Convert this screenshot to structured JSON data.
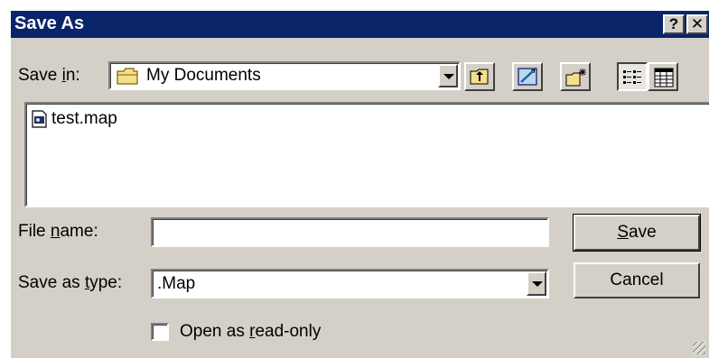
{
  "window": {
    "title": "Save As",
    "help_button": "?",
    "close_button": "✕"
  },
  "save_in": {
    "label_prefix": "Save ",
    "label_accel": "i",
    "label_suffix": "n:",
    "value": "My Documents"
  },
  "toolbar": {
    "icons": [
      "up-one-level-icon",
      "go-to-last-folder-icon",
      "create-new-folder-icon",
      "list-view-icon",
      "details-view-icon"
    ]
  },
  "file_list": {
    "items": [
      {
        "name": "test.map"
      }
    ]
  },
  "file_name": {
    "label_prefix": "File ",
    "label_accel": "n",
    "label_suffix": "ame:",
    "value": ""
  },
  "save_as_type": {
    "label_prefix": "Save as ",
    "label_accel": "t",
    "label_suffix": "ype:",
    "value": ".Map"
  },
  "buttons": {
    "save_accel": "S",
    "save_rest": "ave",
    "cancel": "Cancel"
  },
  "read_only": {
    "label_prefix": "Open as ",
    "label_accel": "r",
    "label_suffix": "ead-only",
    "checked": false
  },
  "colors": {
    "titlebar": "#0a246a",
    "face": "#d4d0c8"
  }
}
